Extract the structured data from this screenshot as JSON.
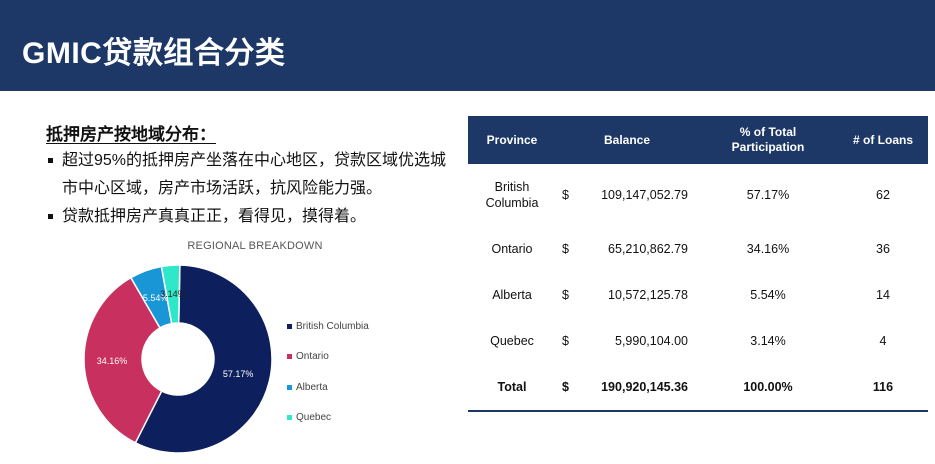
{
  "header": {
    "title": "GMIC贷款组合分类"
  },
  "section": {
    "heading": "抵押房产按地域分布：",
    "bullets": [
      "超过95%的抵押房产坐落在中心地区，贷款区域优选城市中心区域，房产市场活跃，抗风险能力强。",
      "贷款抵押房产真真正正，看得见，摸得着。"
    ]
  },
  "chart_data": {
    "type": "pie",
    "title": "REGIONAL BREAKDOWN",
    "categories": [
      "British Columbia",
      "Ontario",
      "Alberta",
      "Quebec"
    ],
    "values": [
      57.17,
      34.16,
      5.54,
      3.14
    ],
    "labels": [
      "57.17%",
      "34.16%",
      "5.54%",
      "3.14%"
    ],
    "colors": [
      "#0d1f5c",
      "#c7305f",
      "#1896d6",
      "#2ee8c9"
    ],
    "legend": "right"
  },
  "table": {
    "headers": [
      "Province",
      "Balance",
      "% of Total Participation",
      "# of Loans"
    ],
    "rows": [
      {
        "province": "British Columbia",
        "currency": "$",
        "balance": "109,147,052.79",
        "pct": "57.17%",
        "loans": "62"
      },
      {
        "province": "Ontario",
        "currency": "$",
        "balance": "65,210,862.79",
        "pct": "34.16%",
        "loans": "36"
      },
      {
        "province": "Alberta",
        "currency": "$",
        "balance": "10,572,125.78",
        "pct": "5.54%",
        "loans": "14"
      },
      {
        "province": "Quebec",
        "currency": "$",
        "balance": "5,990,104.00",
        "pct": "3.14%",
        "loans": "4"
      }
    ],
    "total": {
      "label": "Total",
      "currency": "$",
      "balance": "190,920,145.36",
      "pct": "100.00%",
      "loans": "116"
    }
  }
}
